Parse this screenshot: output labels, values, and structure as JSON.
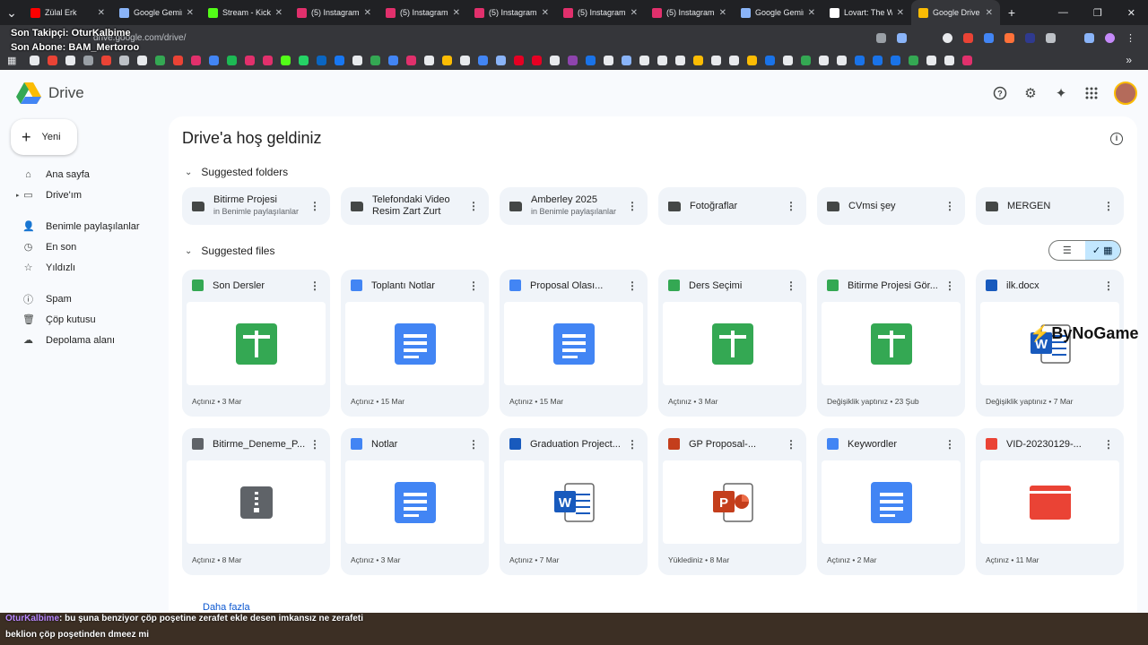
{
  "browser": {
    "tabs": [
      {
        "title": "Zülal Erk",
        "favicon": "youtube-icon",
        "color": "#ff0000"
      },
      {
        "title": "Google Gemini",
        "favicon": "gemini-icon",
        "color": "#8ab4f8"
      },
      {
        "title": "Stream - Kick D",
        "favicon": "kick-icon",
        "color": "#53fc18"
      },
      {
        "title": "(5) Instagram",
        "favicon": "instagram-icon",
        "color": "#e1306c"
      },
      {
        "title": "(5) Instagram",
        "favicon": "instagram-icon",
        "color": "#e1306c"
      },
      {
        "title": "(5) Instagram",
        "favicon": "instagram-icon",
        "color": "#e1306c"
      },
      {
        "title": "(5) Instagram",
        "favicon": "instagram-icon",
        "color": "#e1306c"
      },
      {
        "title": "(5) Instagram",
        "favicon": "instagram-icon",
        "color": "#e1306c"
      },
      {
        "title": "Google Gemini",
        "favicon": "gemini-icon",
        "color": "#8ab4f8"
      },
      {
        "title": "Lovart: The Wo",
        "favicon": "lovart-icon",
        "color": "#ffffff"
      },
      {
        "title": "Google Drive",
        "favicon": "drive-icon",
        "color": "#fbbc04",
        "active": true
      }
    ],
    "url": "drive.google.com/drive/"
  },
  "stream_overlay": {
    "follower": "Son Takipçi: OturKalbime",
    "subscriber": "Son Abone: BAM_Mertoroo",
    "chat_user": "OturKalbime",
    "chat_line1": ": bu şuna benziyor çöp poşetine zerafet ekle desen imkansız ne zerafeti",
    "chat_line2": "beklion çöp poşetinden dmeez mi",
    "sponsor": "ByNoGame"
  },
  "app": {
    "name": "Drive",
    "new_label": "Yeni"
  },
  "sidebar": {
    "items": [
      {
        "label": "Ana sayfa",
        "icon": "home-icon"
      },
      {
        "label": "Drive'ım",
        "icon": "my-drive-icon"
      },
      {
        "label": "Benimle paylaşılanlar",
        "icon": "shared-icon"
      },
      {
        "label": "En son",
        "icon": "clock-icon"
      },
      {
        "label": "Yıldızlı",
        "icon": "star-icon"
      },
      {
        "label": "Spam",
        "icon": "spam-icon"
      },
      {
        "label": "Çöp kutusu",
        "icon": "trash-icon"
      },
      {
        "label": "Depolama alanı",
        "icon": "cloud-icon"
      }
    ]
  },
  "main": {
    "welcome": "Drive'a hoş geldiniz",
    "suggested_folders_label": "Suggested folders",
    "suggested_files_label": "Suggested files",
    "more_label": "Daha fazla",
    "folders": [
      {
        "name": "Bitirme Projesi",
        "sub": "in Benimle paylaşılanlar",
        "shared": true
      },
      {
        "name": "Telefondaki Video Resim Zart Zurt",
        "sub": "",
        "shared": false
      },
      {
        "name": "Amberley 2025",
        "sub": "in Benimle paylaşılanlar",
        "shared": true
      },
      {
        "name": "Fotoğraflar",
        "sub": "",
        "shared": false
      },
      {
        "name": "CVmsi şey",
        "sub": "",
        "shared": false
      },
      {
        "name": "MERGEN",
        "sub": "",
        "shared": false
      }
    ],
    "files": [
      {
        "name": "Son Dersler",
        "type": "sheet",
        "foot": "Açtınız • 3 Mar"
      },
      {
        "name": "Toplantı Notlar",
        "type": "doc",
        "foot": "Açtınız • 15 Mar"
      },
      {
        "name": "Proposal Olası...",
        "type": "doc",
        "foot": "Açtınız • 15 Mar"
      },
      {
        "name": "Ders Seçimi",
        "type": "sheet",
        "foot": "Açtınız • 3 Mar"
      },
      {
        "name": "Bitirme Projesi Gör...",
        "type": "sheet",
        "foot": "Değişiklik yaptınız • 23 Şub"
      },
      {
        "name": "ilk.docx",
        "type": "word",
        "foot": "Değişiklik yaptınız • 7 Mar"
      },
      {
        "name": "Bitirme_Deneme_P...",
        "type": "zip",
        "foot": "Açtınız • 8 Mar"
      },
      {
        "name": "Notlar",
        "type": "doc",
        "foot": "Açtınız • 3 Mar"
      },
      {
        "name": "Graduation Project...",
        "type": "word",
        "foot": "Açtınız • 7 Mar"
      },
      {
        "name": "GP Proposal-...",
        "type": "ppt",
        "foot": "Yüklediniz • 8 Mar"
      },
      {
        "name": "Keywordler",
        "type": "doc",
        "foot": "Açtınız • 2 Mar"
      },
      {
        "name": "VID-20230129-...",
        "type": "video",
        "foot": "Açtınız • 11 Mar"
      }
    ]
  },
  "colors": {
    "sheet": "#34a853",
    "doc": "#4285f4",
    "word": "#185abd",
    "ppt": "#c43e1c",
    "zip": "#5f6368",
    "video": "#ea4335"
  }
}
